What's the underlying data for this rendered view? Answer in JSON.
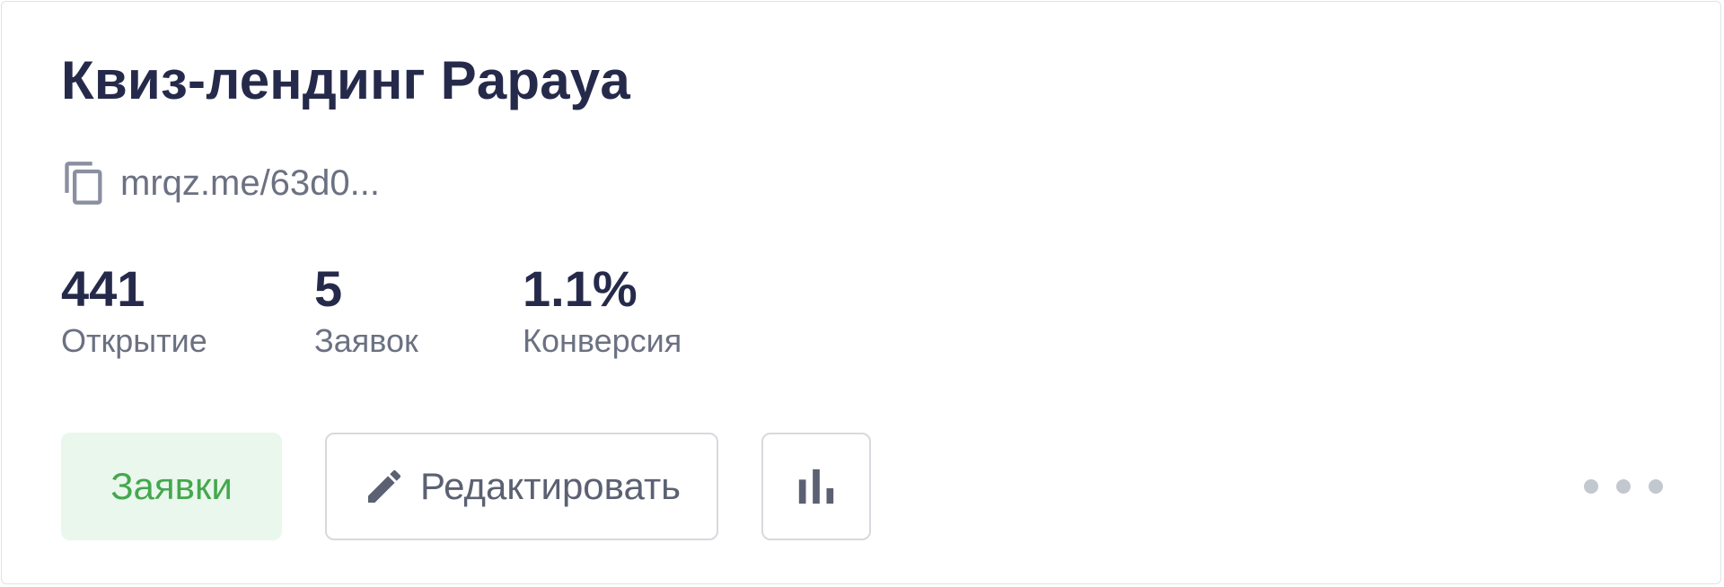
{
  "card": {
    "title": "Квиз-лендинг Papaya",
    "link": {
      "icon": "copy-icon",
      "text": "mrqz.me/63d0..."
    },
    "stats": [
      {
        "value": "441",
        "label": "Открытие"
      },
      {
        "value": "5",
        "label": "Заявок"
      },
      {
        "value": "1.1%",
        "label": "Конверсия"
      }
    ],
    "actions": {
      "leads_label": "Заявки",
      "edit_label": "Редактировать",
      "edit_icon": "pencil-icon",
      "stats_icon": "bar-chart-icon",
      "more_icon": "more-horizontal-icon"
    },
    "colors": {
      "title": "#262a4a",
      "muted": "#6b7181",
      "leads_bg": "#eaf7ed",
      "leads_text": "#43a84d"
    }
  }
}
